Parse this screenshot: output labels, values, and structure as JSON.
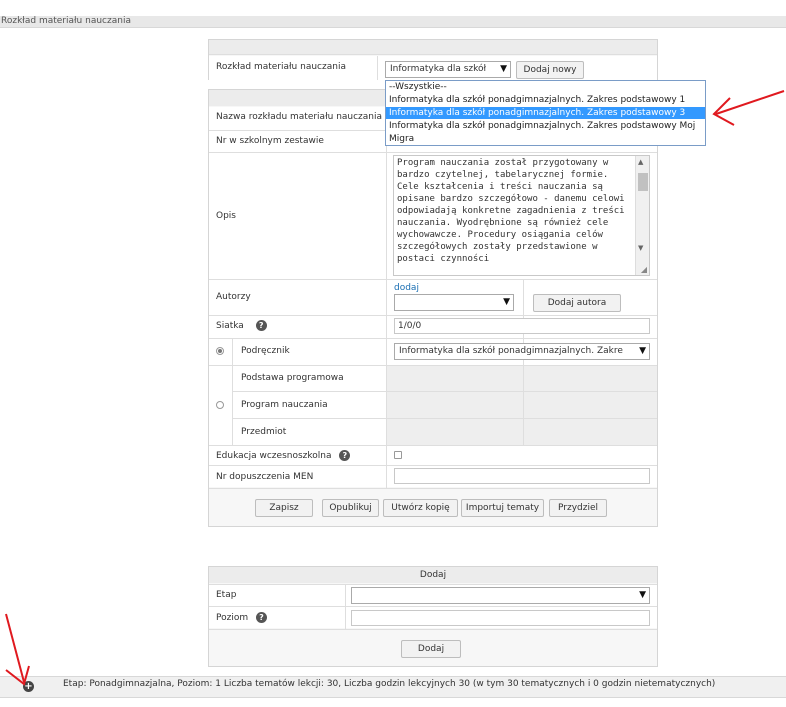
{
  "header": {
    "title": "Rozkład materiału nauczania"
  },
  "top_row": {
    "label": "Rozkład materiału nauczania",
    "select_value": "Informatyka dla szkół",
    "add_new_label": "Dodaj nowy"
  },
  "dropdown": {
    "options": [
      "--Wszystkie--",
      "Informatyka dla szkół ponadgimnazjalnych. Zakres podstawowy 1",
      "Informatyka dla szkół ponadgimnazjalnych. Zakres podstawowy 3",
      "Informatyka dla szkół ponadgimnazjalnych. Zakres podstawowy Moj",
      "Migra"
    ],
    "selected_index": 2
  },
  "form": {
    "name_label": "Nazwa rozkładu materiału nauczania",
    "required_mark": "*",
    "nr_label": "Nr w szkolnym zestawie",
    "opis_label": "Opis",
    "opis_text": "Program nauczania został przygotowany w bardzo czytelnej, tabelarycznej formie. Cele kształcenia i treści nauczania są opisane bardzo szczegółowo - danemu celowi odpowiadają konkretne zagadnienia z treści nauczania. Wyodrębnione są również cele wychowawcze. Procedury osiągania celów szczegółowych zostały przedstawione w postaci czynności",
    "autorzy_label": "Autorzy",
    "dodaj_link": "dodaj",
    "add_author_label": "Dodaj autora",
    "siatka_label": "Siatka",
    "siatka_value": "1/0/0",
    "podrecznik_label": "Podręcznik",
    "podrecznik_value": "Informatyka dla szkół ponadgimnazjalnych. Zakre",
    "podstawa_label": "Podstawa programowa",
    "program_label": "Program nauczania",
    "przedmiot_label": "Przedmiot",
    "edukacja_label": "Edukacja wczesnoszkolna",
    "nr_men_label": "Nr dopuszczenia MEN",
    "buttons": [
      "Zapisz",
      "Opublikuj",
      "Utwórz kopię",
      "Importuj tematy",
      "Przydziel"
    ]
  },
  "add_panel": {
    "title": "Dodaj",
    "etap_label": "Etap",
    "poziom_label": "Poziom",
    "button": "Dodaj"
  },
  "summary": {
    "text": "Etap: Ponadgimnazjalna, Poziom: 1 Liczba tematów lekcji: 30, Liczba godzin lekcyjnych 30 (w tym 30 tematycznych i 0 godzin nietematycznych)"
  },
  "colors": {
    "annotation_red": "#e0191f",
    "selection_blue": "#3399ff"
  },
  "icons": {
    "help": "question-circle",
    "expand": "plus-circle"
  }
}
